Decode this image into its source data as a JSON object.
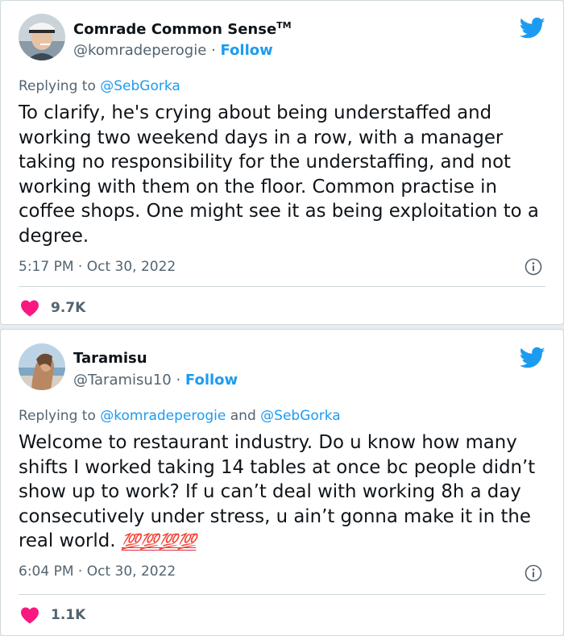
{
  "colors": {
    "accent": "#1d9bf0",
    "heart": "#f91880",
    "muted": "#536471",
    "text": "#0f1419"
  },
  "tweets": [
    {
      "author_name": "Comrade Common Sense",
      "author_name_suffix": "TM",
      "handle": "@komradeperogie",
      "separator": "·",
      "follow_label": "Follow",
      "replying_prefix": "Replying to",
      "replying_mentions": [
        "@SebGorka"
      ],
      "text": "To clarify, he's crying about being understaffed and working two weekend days in a row, with a manager taking no responsibility for the understaffing, and not working with them on the floor. Common practise in coffee shops. One might see it as being exploitation to a degree.",
      "time": "5:17 PM",
      "date": "Oct 30, 2022",
      "likes": "9.7K",
      "icons": [
        "twitter-bird-icon",
        "info-icon",
        "heart-icon"
      ]
    },
    {
      "author_name": "Taramisu",
      "handle": "@Taramisu10",
      "separator": "·",
      "follow_label": "Follow",
      "replying_prefix": "Replying to",
      "replying_mentions": [
        "@komradeperogie",
        "@SebGorka"
      ],
      "replying_joiner": "and",
      "text": "Welcome to restaurant industry. Do u know how many shifts I worked taking 14 tables at once bc people didn’t show up to work? If u can’t deal with working 8h a day consecutively under stress, u ain’t gonna make it in the real world.",
      "emoji": "💯💯💯💯",
      "time": "6:04 PM",
      "date": "Oct 30, 2022",
      "likes": "1.1K",
      "icons": [
        "twitter-bird-icon",
        "info-icon",
        "heart-icon"
      ]
    }
  ]
}
